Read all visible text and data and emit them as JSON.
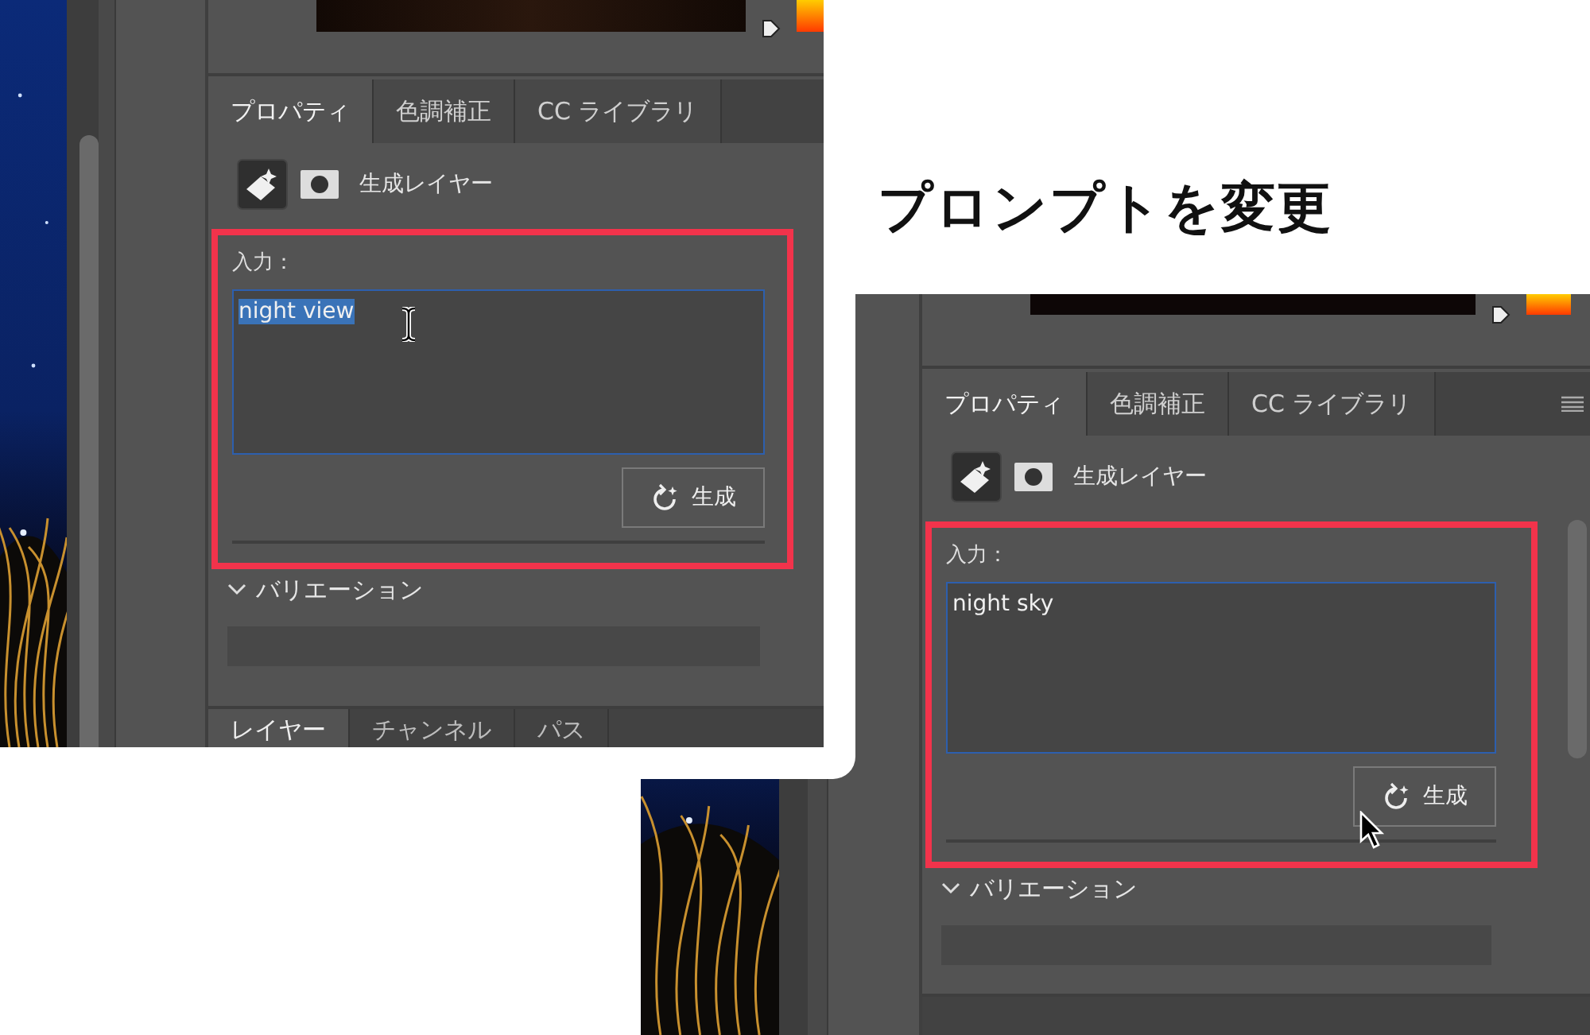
{
  "heading": "プロンプトを変更",
  "shots": [
    {
      "tabs": [
        {
          "label": "プロパティ",
          "selected": true
        },
        {
          "label": "色調補正",
          "selected": false
        },
        {
          "label": "CC ライブラリ",
          "selected": false
        }
      ],
      "layer_label": "生成レイヤー",
      "input_label": "入力：",
      "prompt": {
        "value": "night view",
        "text_selected": true
      },
      "generate_button": "生成",
      "cursor": {
        "kind": "text"
      },
      "section_label": "バリエーション",
      "bottom_tabs": [
        {
          "label": "レイヤー",
          "selected": true
        },
        {
          "label": "チャンネル",
          "selected": false
        },
        {
          "label": "パス",
          "selected": false
        }
      ]
    },
    {
      "tabs": [
        {
          "label": "プロパティ",
          "selected": true
        },
        {
          "label": "色調補正",
          "selected": false
        },
        {
          "label": "CC ライブラリ",
          "selected": false
        }
      ],
      "panel_menu": true,
      "layer_label": "生成レイヤー",
      "input_label": "入力：",
      "prompt": {
        "value": "night sky",
        "text_selected": false
      },
      "generate_button": "生成",
      "cursor": {
        "kind": "arrow"
      },
      "section_label": "バリエーション"
    }
  ]
}
